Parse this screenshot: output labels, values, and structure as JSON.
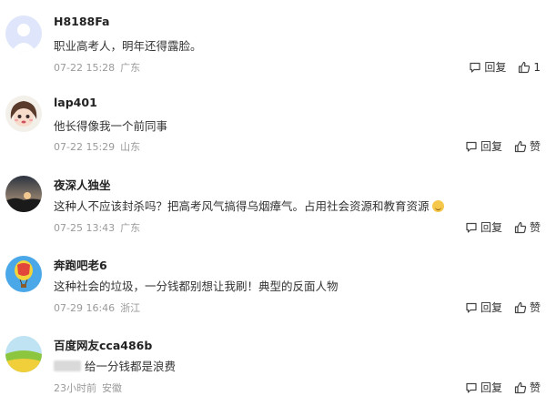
{
  "labels": {
    "reply": "回复",
    "like": "赞"
  },
  "comments": [
    {
      "username": "H8188Fa",
      "text": "职业高考人，明年还得露脸。",
      "time": "07-22 15:28",
      "location": "广东",
      "like_label": "1",
      "avatar_icon": "default-user-avatar"
    },
    {
      "username": "lap401",
      "text": "他长得像我一个前同事",
      "time": "07-22 15:29",
      "location": "山东",
      "like_label": "赞",
      "avatar_icon": "cartoon-girl-avatar"
    },
    {
      "username": "夜深人独坐",
      "text": "这种人不应该封杀吗？把高考风气搞得乌烟瘴气。占用社会资源和教育资源",
      "time": "07-25 13:43",
      "location": "广东",
      "like_label": "赞",
      "avatar_icon": "sunset-landscape-avatar"
    },
    {
      "username": "奔跑吧老6",
      "text": "这种社会的垃圾，一分钱都别想让我刷！典型的反面人物",
      "time": "07-29 16:46",
      "location": "浙江",
      "like_label": "赞",
      "avatar_icon": "hot-air-balloon-avatar"
    },
    {
      "username": "百度网友cca486b",
      "text": "给一分钱都是浪费",
      "time": "23小时前",
      "location": "安徽",
      "like_label": "赞",
      "avatar_icon": "green-field-avatar"
    }
  ]
}
